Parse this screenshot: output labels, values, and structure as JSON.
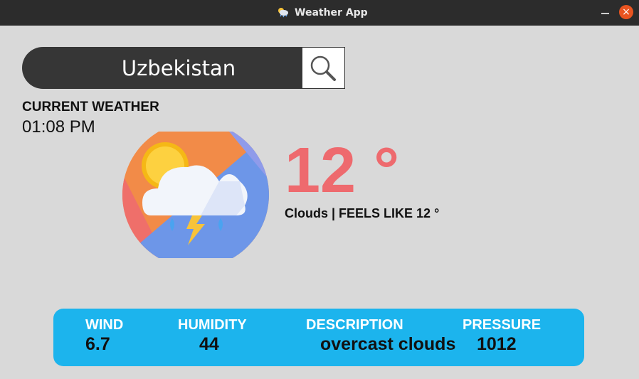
{
  "window": {
    "title": "Weather App",
    "close_glyph": "×"
  },
  "search": {
    "value": "Uzbekistan",
    "icon": "search-icon"
  },
  "current": {
    "label": "CURRENT WEATHER",
    "time": "01:08 PM",
    "temperature": "12 °",
    "condition": "Clouds | FEELS LIKE 12 °",
    "icon": "cloud-sun-storm-icon"
  },
  "details": {
    "wind": {
      "label": "WIND",
      "value": "6.7"
    },
    "humidity": {
      "label": "HUMIDITY",
      "value": "44"
    },
    "description": {
      "label": "DESCRIPTION",
      "value": "overcast clouds"
    },
    "pressure": {
      "label": "PRESSURE",
      "value": "1012"
    }
  },
  "colors": {
    "titlebar": "#2c2c2c",
    "background": "#d9d9d9",
    "search_bar": "#363636",
    "temperature": "#ee6a6e",
    "details_panel": "#1cb4ed",
    "close_button": "#e95420"
  }
}
